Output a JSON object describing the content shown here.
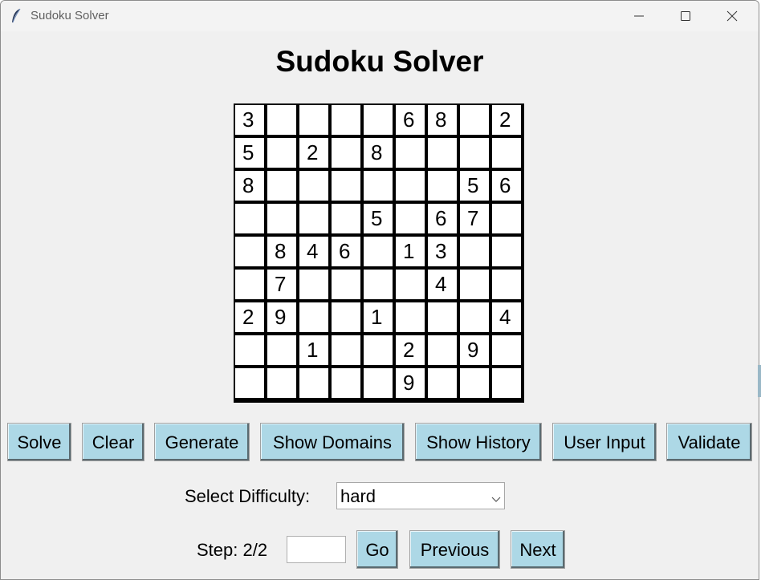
{
  "window": {
    "title": "Sudoku Solver",
    "app_icon": "feather-icon",
    "controls": [
      "minimize-icon",
      "maximize-icon",
      "close-icon"
    ]
  },
  "heading": "Sudoku Solver",
  "grid": [
    [
      "3",
      "",
      "",
      "",
      "",
      "6",
      "8",
      "",
      "2"
    ],
    [
      "5",
      "",
      "2",
      "",
      "8",
      "",
      "",
      "",
      ""
    ],
    [
      "8",
      "",
      "",
      "",
      "",
      "",
      "",
      "5",
      "6"
    ],
    [
      "",
      "",
      "",
      "",
      "5",
      "",
      "6",
      "7",
      ""
    ],
    [
      "",
      "8",
      "4",
      "6",
      "",
      "1",
      "3",
      "",
      ""
    ],
    [
      "",
      "7",
      "",
      "",
      "",
      "",
      "4",
      "",
      ""
    ],
    [
      "2",
      "9",
      "",
      "",
      "1",
      "",
      "",
      "",
      "4"
    ],
    [
      "",
      "",
      "1",
      "",
      "",
      "2",
      "",
      "9",
      ""
    ],
    [
      "",
      "",
      "",
      "",
      "",
      "9",
      "",
      "",
      ""
    ]
  ],
  "buttons": {
    "solve": "Solve",
    "clear": "Clear",
    "generate": "Generate",
    "show_domains": "Show Domains",
    "show_history": "Show History",
    "user_input": "User Input",
    "validate": "Validate"
  },
  "difficulty": {
    "label": "Select Difficulty:",
    "value": "hard"
  },
  "step": {
    "label": "Step: 2/2",
    "input_value": "",
    "go": "Go",
    "previous": "Previous",
    "next": "Next"
  },
  "colors": {
    "button_bg": "#add8e6",
    "window_bg": "#f0f0f0"
  }
}
